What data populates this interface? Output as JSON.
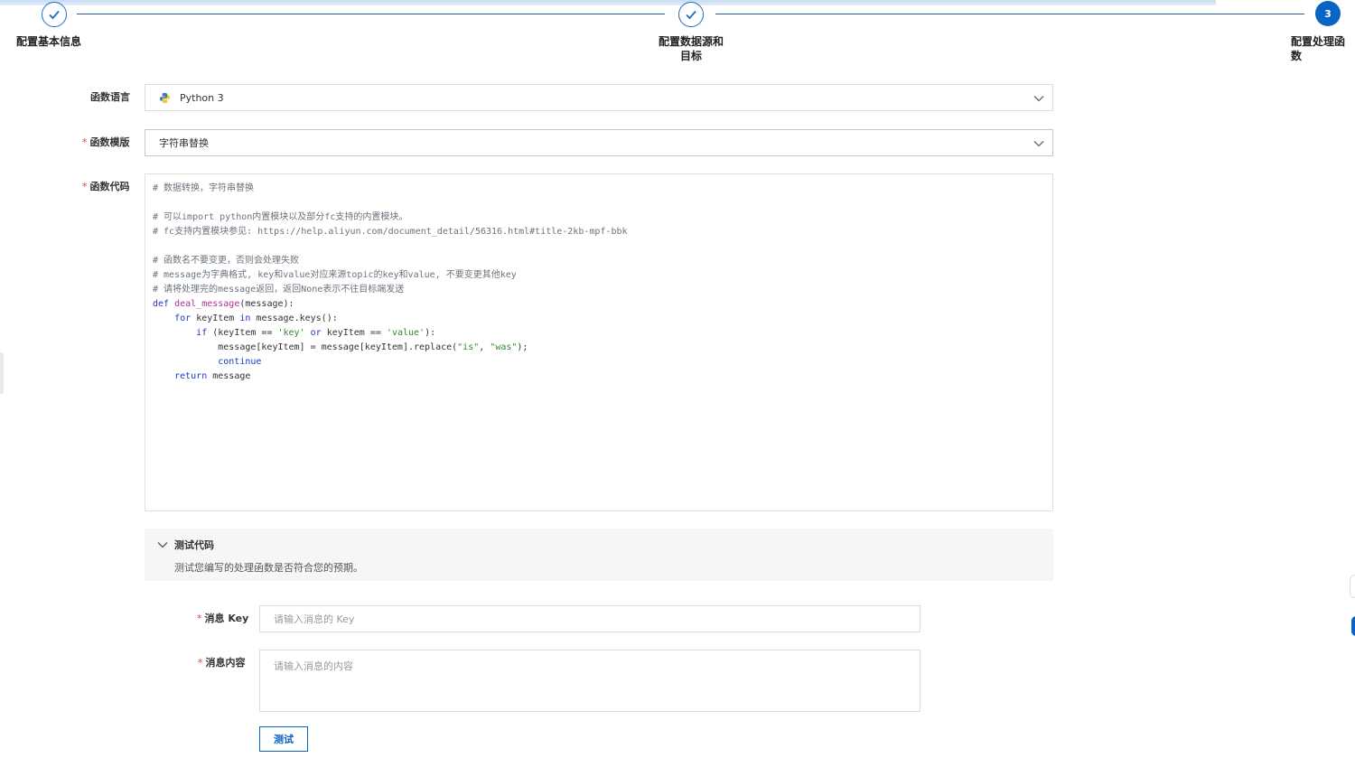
{
  "steps": [
    {
      "label": "配置基本信息",
      "status": "done"
    },
    {
      "label": "配置数据源和\n目标",
      "status": "done"
    },
    {
      "label": "配置处理函数",
      "status": "active",
      "number": "3"
    }
  ],
  "form": {
    "language": {
      "label": "函数语言",
      "value": "Python 3",
      "icon": "python-icon"
    },
    "template": {
      "label": "函数模版",
      "value": "字符串替换"
    },
    "code": {
      "label": "函数代码",
      "lines": [
        [
          {
            "t": "# 数据转换，字符串替换",
            "c": "comment"
          }
        ],
        [],
        [
          {
            "t": "# 可以import python内置模块以及部分fc支持的内置模块。",
            "c": "comment"
          }
        ],
        [
          {
            "t": "# fc支持内置模块参见: https://help.aliyun.com/document_detail/56316.html#title-2kb-mpf-bbk",
            "c": "comment"
          }
        ],
        [],
        [
          {
            "t": "# 函数名不要变更，否则会处理失败",
            "c": "comment"
          }
        ],
        [
          {
            "t": "# message为字典格式, key和value对应来源topic的key和value, 不要变更其他key",
            "c": "comment"
          }
        ],
        [
          {
            "t": "# 请将处理完的message返回，返回None表示不往目标端发送",
            "c": "comment"
          }
        ],
        [
          {
            "t": "def ",
            "c": "kw"
          },
          {
            "t": "deal_message",
            "c": "fn"
          },
          {
            "t": "(message):",
            "c": ""
          }
        ],
        [
          {
            "t": "    ",
            "c": ""
          },
          {
            "t": "for ",
            "c": "kw"
          },
          {
            "t": "keyItem ",
            "c": ""
          },
          {
            "t": "in ",
            "c": "kw"
          },
          {
            "t": "message.keys():",
            "c": ""
          }
        ],
        [
          {
            "t": "        ",
            "c": ""
          },
          {
            "t": "if ",
            "c": "kw"
          },
          {
            "t": "(keyItem == ",
            "c": ""
          },
          {
            "t": "'key'",
            "c": "str"
          },
          {
            "t": " or ",
            "c": "kw"
          },
          {
            "t": "keyItem == ",
            "c": ""
          },
          {
            "t": "'value'",
            "c": "str"
          },
          {
            "t": "):",
            "c": ""
          }
        ],
        [
          {
            "t": "            message[keyItem] = message[keyItem].replace(",
            "c": ""
          },
          {
            "t": "\"is\"",
            "c": "str"
          },
          {
            "t": ", ",
            "c": ""
          },
          {
            "t": "\"was\"",
            "c": "str"
          },
          {
            "t": ");",
            "c": ""
          }
        ],
        [
          {
            "t": "            ",
            "c": ""
          },
          {
            "t": "continue",
            "c": "kw"
          }
        ],
        [
          {
            "t": "    ",
            "c": ""
          },
          {
            "t": "return ",
            "c": "kw"
          },
          {
            "t": "message",
            "c": ""
          }
        ]
      ]
    }
  },
  "test": {
    "title": "测试代码",
    "description": "测试您编写的处理函数是否符合您的预期。",
    "key": {
      "label": "消息 Key",
      "placeholder": "请输入消息的 Key"
    },
    "content": {
      "label": "消息内容",
      "placeholder": "请输入消息的内容"
    },
    "button": "测试"
  },
  "colors": {
    "primary": "#0a64c4",
    "required": "#e53935"
  }
}
